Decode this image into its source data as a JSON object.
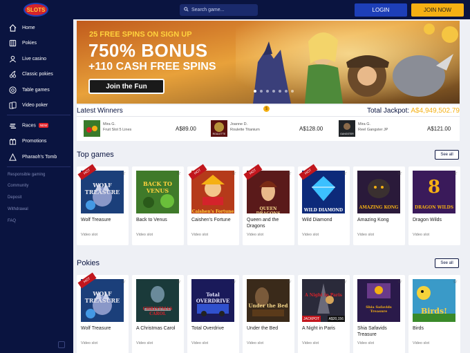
{
  "header": {
    "logo_text": "SLOTS",
    "search_placeholder": "Search game...",
    "login_label": "LOGIN",
    "join_label": "JOIN NOW"
  },
  "sidebar": {
    "items": [
      {
        "label": "Home",
        "icon": "home-icon"
      },
      {
        "label": "Pokies",
        "icon": "pokies-icon"
      },
      {
        "label": "Live casino",
        "icon": "live-casino-icon"
      },
      {
        "label": "Classic pokies",
        "icon": "cherry-icon"
      },
      {
        "label": "Table games",
        "icon": "chip-icon"
      },
      {
        "label": "Video poker",
        "icon": "cards-icon"
      },
      {
        "label": "Races",
        "icon": "races-icon",
        "badge": "NEW"
      },
      {
        "label": "Promotions",
        "icon": "gift-icon"
      },
      {
        "label": "Pharaoh's Tomb",
        "icon": "pyramid-icon"
      }
    ],
    "links": [
      "Responsible gaming",
      "Community",
      "Deposit",
      "Withdrawal",
      "FAQ"
    ]
  },
  "banner": {
    "line1": "25 FREE SPINS ON SIGN UP",
    "line2": "750% BONUS",
    "line3": "+110 CASH FREE SPINS",
    "cta": "Join the Fun",
    "slides": 7,
    "active_slide": 0
  },
  "winners": {
    "title": "Latest Winners",
    "jackpot_label": "Total Jackpot:",
    "jackpot_value": "A$4,949,502.79",
    "entries": [
      {
        "who": "Mira G.",
        "game": "Fruit Slot 5 Lines",
        "amount": "A$89.00"
      },
      {
        "who": "Joanne D.",
        "game": "Roulette Titanium",
        "amount": "A$128.00"
      },
      {
        "who": "Mira G.",
        "game": "Reel Gangster JP",
        "amount": "A$121.00"
      }
    ]
  },
  "top_games": {
    "title": "Top games",
    "see_all": "See all",
    "games": [
      {
        "name": "Wolf Treasure",
        "type": "Video slot",
        "hot": true
      },
      {
        "name": "Back to Venus",
        "type": "Video slot",
        "hot": false
      },
      {
        "name": "Caishen's Fortune",
        "type": "Video slot",
        "hot": true
      },
      {
        "name": "Queen and the Dragons",
        "type": "Video slot",
        "hot": true
      },
      {
        "name": "Wild Diamond",
        "type": "Video slot",
        "hot": true
      },
      {
        "name": "Amazing Kong",
        "type": "Video slot",
        "hot": false
      },
      {
        "name": "Dragon Wilds",
        "type": "Video slot",
        "hot": false
      }
    ]
  },
  "pokies": {
    "title": "Pokies",
    "see_all": "See all",
    "games": [
      {
        "name": "Wolf Treasure",
        "type": "Video slot",
        "hot": true
      },
      {
        "name": "A Christmas Carol",
        "type": "Video slot",
        "hot": false
      },
      {
        "name": "Total Overdrive",
        "type": "Video slot",
        "hot": false
      },
      {
        "name": "Under the Bed",
        "type": "Video slot",
        "hot": false
      },
      {
        "name": "A Night in Paris",
        "type": "Video slot",
        "hot": false,
        "jackpot_label": "JACKPOT",
        "jackpot_value": "A$20,156"
      },
      {
        "name": "Shia Safavids Treasure",
        "type": "Video slot",
        "hot": false
      },
      {
        "name": "Birds",
        "type": "Video slot",
        "hot": false
      }
    ]
  },
  "art_labels": {
    "wolf": "WOLF TREASURE",
    "venus": "BACK TO VENUS",
    "caishen": "Caishen's Fortune",
    "queen": "QUEEN DRAGONS",
    "diamond": "WILD DIAMOND",
    "kong": "AMAZING KONG",
    "dragon": "DRAGON WILDS",
    "christmas": "CHRISTMAS CAROL",
    "overdrive": "Total OVERDRIVE",
    "underbed": "Under the Bed",
    "paris": "A Night in Paris",
    "shia": "Shia Safavids Treasure",
    "birds": "Birds!",
    "hot": "HOT",
    "roulette": "ROULETTE",
    "gangster": "GANGSTER"
  },
  "colors": {
    "navy": "#0a1440",
    "accent_gold": "#f5b013",
    "login_blue": "#1d3fb8",
    "hot_red": "#c1161d"
  }
}
